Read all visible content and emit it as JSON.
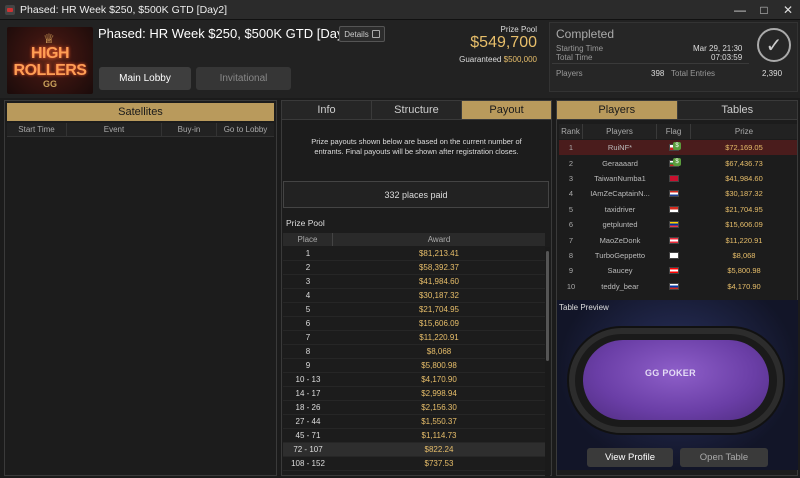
{
  "window": {
    "title": "Phased: HR Week $250, $500K GTD [Day2]"
  },
  "logo": {
    "line1": "HIGH",
    "line2": "ROLLERS",
    "line3": "GG"
  },
  "header": {
    "tournament_name": "Phased: HR Week $250, $500K GTD [Day2]",
    "details_label": "Details",
    "main_lobby_label": "Main Lobby",
    "invitational_label": "Invitational",
    "prize_pool_label": "Prize Pool",
    "prize_pool_value": "$549,700",
    "guaranteed_label": "Guaranteed",
    "guaranteed_value": "$500,000"
  },
  "status": {
    "title": "Completed",
    "starting_time_label": "Starting Time",
    "starting_time_value": "Mar 29, 21:30",
    "total_time_label": "Total Time",
    "total_time_value": "07:03:59",
    "players_label": "Players",
    "players_value": "398",
    "total_entries_label": "Total Entries",
    "total_entries_value": "2,390"
  },
  "satellites": {
    "title": "Satellites",
    "columns": [
      "Start Time",
      "Event",
      "Buy-in",
      "Go to Lobby"
    ]
  },
  "info_tabs": {
    "tabs": [
      "Info",
      "Structure",
      "Payout"
    ],
    "active": "Payout"
  },
  "payout": {
    "note_line1": "Prize payouts shown below are based on the current number of",
    "note_line2": "entrants. Final payouts will be shown after registration closes.",
    "places_paid": "332 places paid",
    "prize_pool_title": "Prize Pool",
    "col_place": "Place",
    "col_award": "Award",
    "rows": [
      {
        "place": "1",
        "award": "$81,213.41"
      },
      {
        "place": "2",
        "award": "$58,392.37"
      },
      {
        "place": "3",
        "award": "$41,984.60"
      },
      {
        "place": "4",
        "award": "$30,187.32"
      },
      {
        "place": "5",
        "award": "$21,704.95"
      },
      {
        "place": "6",
        "award": "$15,606.09"
      },
      {
        "place": "7",
        "award": "$11,220.91"
      },
      {
        "place": "8",
        "award": "$8,068"
      },
      {
        "place": "9",
        "award": "$5,800.98"
      },
      {
        "place": "10 - 13",
        "award": "$4,170.90"
      },
      {
        "place": "14 - 17",
        "award": "$2,998.94"
      },
      {
        "place": "18 - 26",
        "award": "$2,156.30"
      },
      {
        "place": "27 - 44",
        "award": "$1,550.37"
      },
      {
        "place": "45 - 71",
        "award": "$1,114.73"
      },
      {
        "place": "72 - 107",
        "award": "$822.24"
      },
      {
        "place": "108 - 152",
        "award": "$737.53"
      }
    ]
  },
  "player_tabs": {
    "tabs": [
      "Players",
      "Tables"
    ],
    "active": "Players"
  },
  "players": {
    "col_rank": "Rank",
    "col_players": "Players",
    "col_flag": "Flag",
    "col_prize": "Prize",
    "rows": [
      {
        "rank": "1",
        "name": "RuiNF*",
        "prize": "$72,169.05",
        "flag": [
          "#ffffff",
          "#cc2222"
        ],
        "badge": "$"
      },
      {
        "rank": "2",
        "name": "Geraaaard",
        "prize": "$67,436.73",
        "flag": [
          "#ffffff",
          "#2f8a3a",
          "#cc2222"
        ],
        "badge": "$"
      },
      {
        "rank": "3",
        "name": "TaiwanNumba1",
        "prize": "$41,984.60",
        "flag": [
          "#c8102e",
          "#c8102e"
        ]
      },
      {
        "rank": "4",
        "name": "IAmZeCaptainN...",
        "prize": "$30,187.32",
        "flag": [
          "#d52b1e",
          "#ffffff",
          "#1c3f94"
        ]
      },
      {
        "rank": "5",
        "name": "taxidriver",
        "prize": "$21,704.95",
        "flag": [
          "#d52b1e",
          "#ffffff"
        ]
      },
      {
        "rank": "6",
        "name": "getplunted",
        "prize": "$15,606.09",
        "flag": [
          "#ffd100",
          "#0033a0",
          "#ef3340"
        ]
      },
      {
        "rank": "7",
        "name": "MaoZeDonk",
        "prize": "$11,220.91",
        "flag": [
          "#ed2939",
          "#ffffff",
          "#ed2939"
        ]
      },
      {
        "rank": "8",
        "name": "TurboGeppetto",
        "prize": "$8,068",
        "flag": [
          "#ffffff"
        ]
      },
      {
        "rank": "9",
        "name": "Saucey",
        "prize": "$5,800.98",
        "flag": [
          "#ff0000",
          "#ffffff",
          "#ff0000"
        ]
      },
      {
        "rank": "10",
        "name": "teddy_bear",
        "prize": "$4,170.90",
        "flag": [
          "#ffffff",
          "#0039a6",
          "#d52b1e"
        ]
      }
    ]
  },
  "preview": {
    "label": "Table Preview",
    "table_logo": "GG POKER",
    "view_profile_label": "View Profile",
    "open_table_label": "Open Table"
  }
}
